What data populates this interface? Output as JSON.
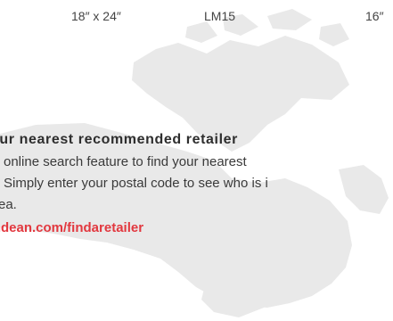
{
  "specs": {
    "size": "18″ x 24″",
    "model": "LM15",
    "size2": "16″"
  },
  "retailer": {
    "heading": "our nearest recommended retailer",
    "line1": "online search feature to find your nearest",
    "line2": "Simply enter your postal code to see who is i",
    "line3": "ea.",
    "link": "rndean.com/findaretailer"
  },
  "colors": {
    "link": "#e2383f",
    "map": "#e8e8e8"
  },
  "icons": [
    "canada-map-watermark"
  ]
}
